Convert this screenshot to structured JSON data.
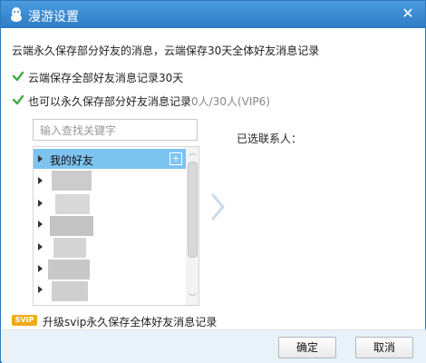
{
  "window": {
    "title": "漫游设置",
    "close_glyph": "✕"
  },
  "description": "云端永久保存部分好友的消息，云端保存30天全体好友消息记录",
  "options": {
    "save_all_30_days": {
      "label": "云端保存全部好友消息记录30天",
      "checked": true
    },
    "save_some_forever": {
      "label": "也可以永久保存部分好友消息记录",
      "quota": "0人/30人(VIP6)",
      "checked": true
    }
  },
  "search": {
    "placeholder": "输入查找关键字",
    "value": ""
  },
  "friend_groups": {
    "first_group_label": "我的好友",
    "add_glyph": "+"
  },
  "selected_contacts": {
    "label": "已选联系人："
  },
  "svip": {
    "badge": "SVIP",
    "text": "升级svip永久保存全体好友消息记录"
  },
  "buttons": {
    "ok": "确定",
    "cancel": "取消"
  },
  "colors": {
    "titlebar": "#3a8ad2",
    "selected_row": "#7dc3ef",
    "check_green": "#3fae3f",
    "svip_badge": "#f0a81c",
    "footer": "#eaf2f9"
  }
}
